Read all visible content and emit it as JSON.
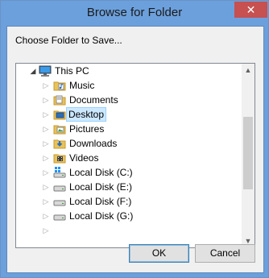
{
  "dialog": {
    "title": "Browse for Folder",
    "close_glyph": "✕",
    "instruction": "Choose Folder to Save..."
  },
  "tree": {
    "root": {
      "label": "This PC",
      "icon": "computer-icon",
      "expanded": true
    },
    "items": [
      {
        "label": "Music",
        "icon": "music-folder-icon",
        "selected": false
      },
      {
        "label": "Documents",
        "icon": "documents-folder-icon",
        "selected": false
      },
      {
        "label": "Desktop",
        "icon": "desktop-folder-icon",
        "selected": true
      },
      {
        "label": "Pictures",
        "icon": "pictures-folder-icon",
        "selected": false
      },
      {
        "label": "Downloads",
        "icon": "downloads-folder-icon",
        "selected": false
      },
      {
        "label": "Videos",
        "icon": "videos-folder-icon",
        "selected": false
      },
      {
        "label": "Local Disk (C:)",
        "icon": "windows-drive-icon",
        "selected": false
      },
      {
        "label": "Local Disk (E:)",
        "icon": "drive-icon",
        "selected": false
      },
      {
        "label": "Local Disk (F:)",
        "icon": "drive-icon",
        "selected": false
      },
      {
        "label": "Local Disk (G:)",
        "icon": "drive-icon",
        "selected": false
      }
    ]
  },
  "buttons": {
    "ok_label": "OK",
    "cancel_label": "Cancel"
  },
  "colors": {
    "title_bar": "#6ca0dc",
    "close_button": "#c75050",
    "selection_fill": "#cce8ff",
    "selection_border": "#99d1ff"
  }
}
